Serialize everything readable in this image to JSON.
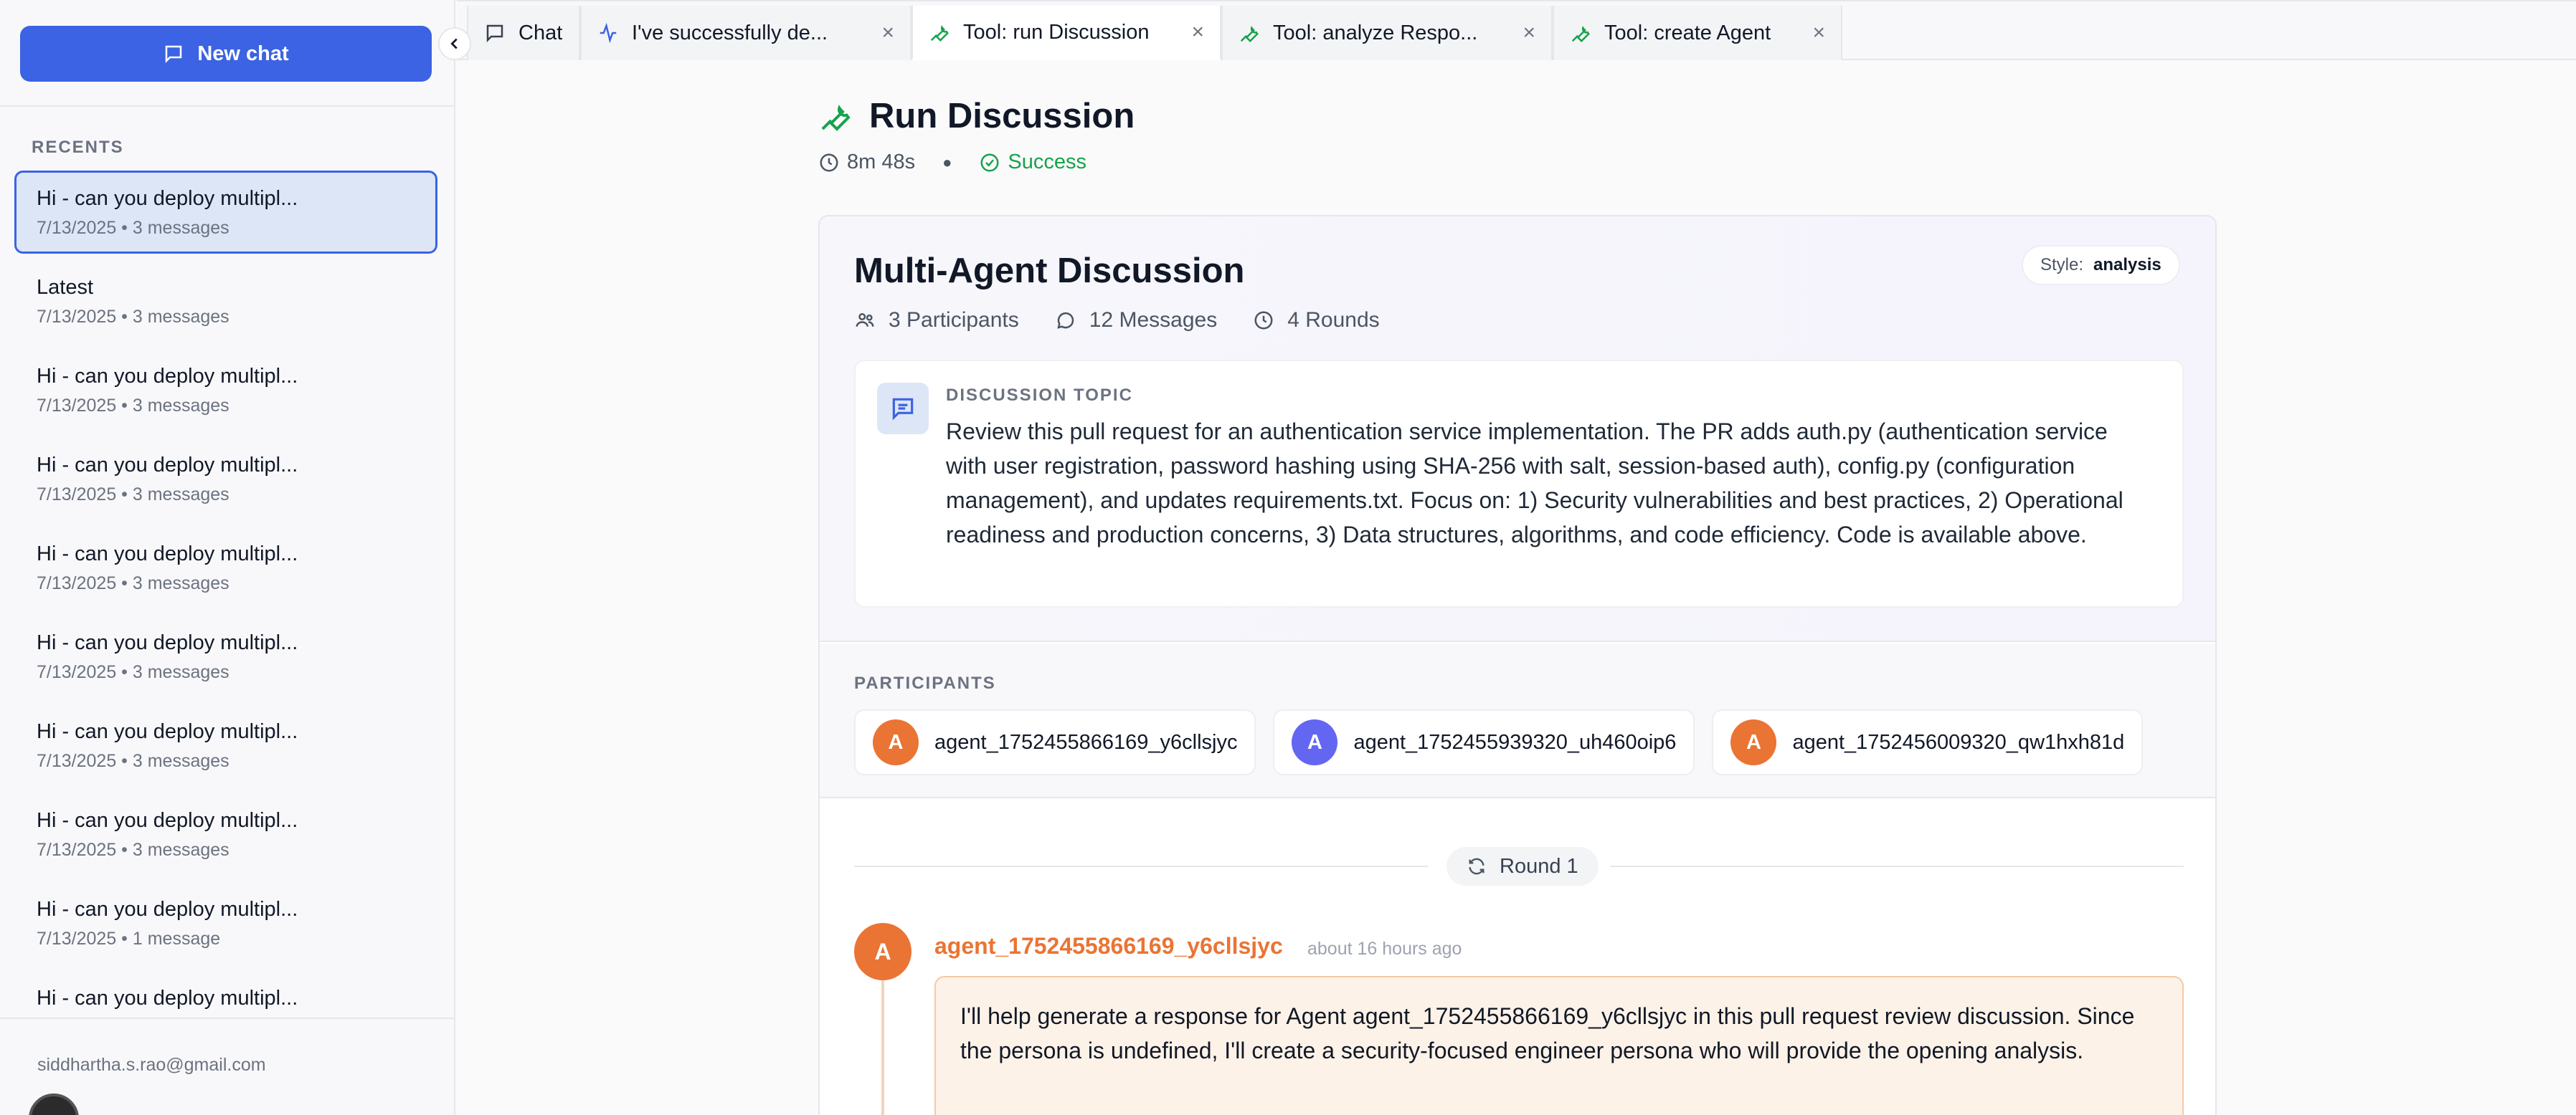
{
  "sidebar": {
    "new_chat_label": "New chat",
    "recents_label": "RECENTS",
    "items": [
      {
        "title": "Hi - can you deploy multipl...",
        "meta": "7/13/2025 • 3 messages",
        "active": true
      },
      {
        "title": "Latest",
        "meta": "7/13/2025 • 3 messages",
        "active": false
      },
      {
        "title": "Hi - can you deploy multipl...",
        "meta": "7/13/2025 • 3 messages",
        "active": false
      },
      {
        "title": "Hi - can you deploy multipl...",
        "meta": "7/13/2025 • 3 messages",
        "active": false
      },
      {
        "title": "Hi - can you deploy multipl...",
        "meta": "7/13/2025 • 3 messages",
        "active": false
      },
      {
        "title": "Hi - can you deploy multipl...",
        "meta": "7/13/2025 • 3 messages",
        "active": false
      },
      {
        "title": "Hi - can you deploy multipl...",
        "meta": "7/13/2025 • 3 messages",
        "active": false
      },
      {
        "title": "Hi - can you deploy multipl...",
        "meta": "7/13/2025 • 3 messages",
        "active": false
      },
      {
        "title": "Hi - can you deploy multipl...",
        "meta": "7/13/2025 • 1 message",
        "active": false
      },
      {
        "title": "Hi - can you deploy multipl...",
        "meta": "",
        "active": false
      }
    ],
    "user_email": "siddhartha.s.rao@gmail.com"
  },
  "tabs": [
    {
      "label": "Chat",
      "icon": "chat-icon",
      "closable": false,
      "active": false
    },
    {
      "label": "I've successfully de...",
      "icon": "activity-icon",
      "closable": true,
      "active": false
    },
    {
      "label": "Tool: run Discussion",
      "icon": "wrench-icon",
      "closable": true,
      "active": true
    },
    {
      "label": "Tool: analyze Respo...",
      "icon": "wrench-icon",
      "closable": true,
      "active": false
    },
    {
      "label": "Tool: create Agent",
      "icon": "wrench-icon",
      "closable": true,
      "active": false
    }
  ],
  "header": {
    "title": "Run Discussion",
    "duration": "8m 48s",
    "status": "Success"
  },
  "discussion": {
    "title": "Multi-Agent Discussion",
    "style_label": "Style:",
    "style_value": "analysis",
    "participants_count": "3 Participants",
    "messages_count": "12 Messages",
    "rounds_count": "4 Rounds",
    "topic_label": "DISCUSSION TOPIC",
    "topic_text": "Review this pull request for an authentication service implementation. The PR adds auth.py (authentication service with user registration, password hashing using SHA-256 with salt, session-based auth), config.py (configuration management), and updates requirements.txt. Focus on: 1) Security vulnerabilities and best practices, 2) Operational readiness and production concerns, 3) Data structures, algorithms, and code efficiency. Code is available above.",
    "participants_label": "PARTICIPANTS",
    "participants": [
      {
        "initial": "A",
        "name": "agent_1752455866169_y6cllsjyc",
        "color": "#ea7433"
      },
      {
        "initial": "A",
        "name": "agent_1752455939320_uh460oip6",
        "color": "#6366f1"
      },
      {
        "initial": "A",
        "name": "agent_1752456009320_qw1hxh81d",
        "color": "#ea7433"
      }
    ],
    "round_label": "Round 1",
    "message": {
      "initial": "A",
      "author": "agent_1752455866169_y6cllsjyc",
      "time": "about 16 hours ago",
      "text": "I'll help generate a response for Agent agent_1752455866169_y6cllsjyc in this pull request review discussion. Since the persona is undefined, I'll create a security-focused engineer persona who will provide the opening analysis."
    }
  },
  "colors": {
    "accent": "#3b63e3",
    "success": "#16a34a",
    "agent_orange": "#ea7433",
    "agent_indigo": "#6366f1"
  }
}
